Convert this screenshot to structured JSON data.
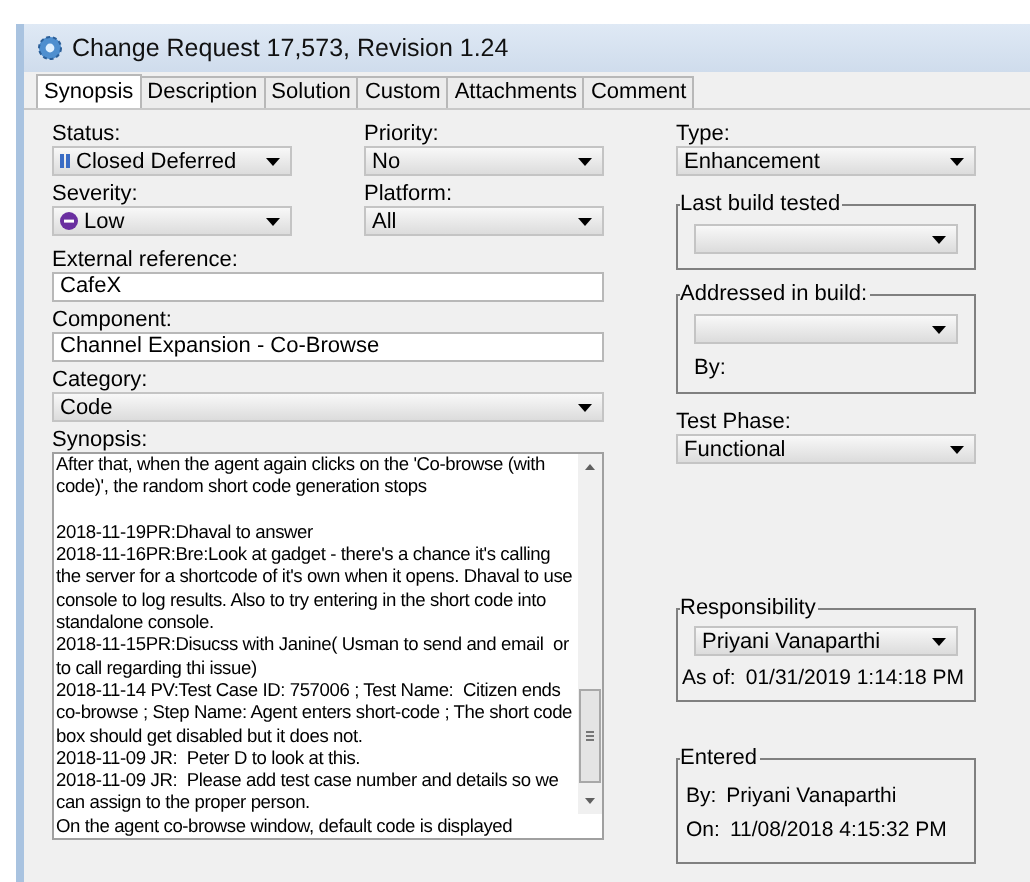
{
  "window": {
    "title": "Change Request 17,573, Revision 1.24"
  },
  "tabs": [
    {
      "label": "Synopsis",
      "selected": true
    },
    {
      "label": "Description",
      "selected": false
    },
    {
      "label": "Solution",
      "selected": false
    },
    {
      "label": "Custom",
      "selected": false
    },
    {
      "label": "Attachments",
      "selected": false
    },
    {
      "label": "Comment",
      "selected": false
    }
  ],
  "status": {
    "label": "Status:",
    "value": "Closed Deferred"
  },
  "priority": {
    "label": "Priority:",
    "value": "No"
  },
  "type": {
    "label": "Type:",
    "value": "Enhancement"
  },
  "severity": {
    "label": "Severity:",
    "value": "Low"
  },
  "platform": {
    "label": "Platform:",
    "value": "All"
  },
  "last_build_tested": {
    "label": "Last build tested"
  },
  "external_reference": {
    "label": "External reference:",
    "value": "CafeX"
  },
  "addressed_in_build": {
    "label": "Addressed in build:",
    "by_label": "By:"
  },
  "component": {
    "label": "Component:",
    "value": "Channel Expansion - Co-Browse"
  },
  "category": {
    "label": "Category:",
    "value": "Code"
  },
  "test_phase": {
    "label": "Test Phase:",
    "value": "Functional"
  },
  "synopsis": {
    "label": "Synopsis:",
    "value": "After that, when the agent again clicks on the 'Co-browse (with code)', the random short code generation stops\n\n2018-11-19PR:Dhaval to answer\n2018-11-16PR:Bre:Look at gadget - there's a chance it's calling the server for a shortcode of it's own when it opens. Dhaval to use console to log results. Also to try entering in the short code into standalone console.\n2018-11-15PR:Disucss with Janine( Usman to send and email  or to call regarding thi issue)\n2018-11-14 PV:Test Case ID: 757006 ; Test Name:  Citizen ends co-browse ; Step Name: Agent enters short-code ; The short code box should get disabled but it does not.\n2018-11-09 JR:  Peter D to look at this.\n2018-11-09 JR:  Please add test case number and details so we can assign to the proper person.\nOn the agent co-browse window, default code is displayed"
  },
  "responsibility": {
    "label": "Responsibility",
    "value": "Priyani Vanaparthi",
    "as_of_label": "As of:",
    "as_of": "01/31/2019 1:14:18 PM"
  },
  "entered": {
    "label": "Entered",
    "by_label": "By:",
    "by": "Priyani Vanaparthi",
    "on_label": "On:",
    "on": "11/08/2018 4:15:32 PM"
  }
}
